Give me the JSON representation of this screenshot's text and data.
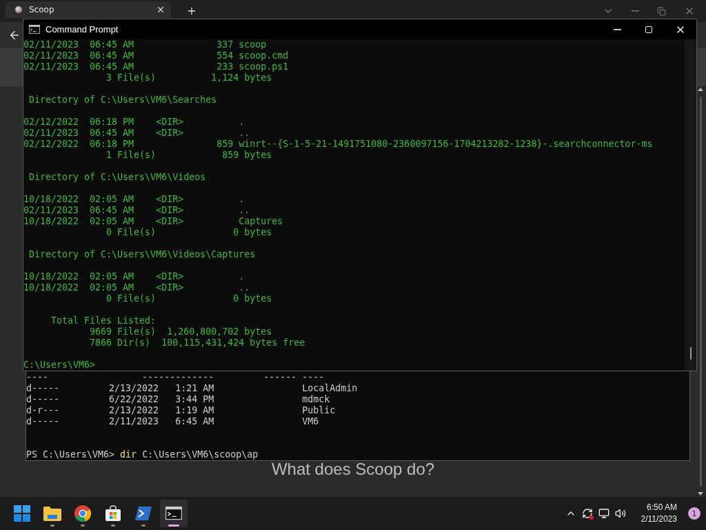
{
  "browser": {
    "tab": {
      "title": "Scoop"
    },
    "heading": "What does Scoop do?"
  },
  "powershell": {
    "lines": [
      "----                 -------------         ------ ----",
      "d-----         2/13/2022   1:21 AM                LocalAdmin",
      "d-----         6/22/2022   3:44 PM                mdmck",
      "d-r---         2/13/2022   1:19 AM                Public",
      "d-----         2/11/2023   6:45 AM                VM6"
    ],
    "prompt": "PS C:\\Users\\VM6>",
    "command": "dir",
    "argument": "C:\\Users\\VM6\\scoop\\ap"
  },
  "cmd": {
    "title": "Command Prompt",
    "blocks": [
      [
        "02/11/2023  06:45 AM               337 scoop",
        "02/11/2023  06:45 AM               554 scoop.cmd",
        "02/11/2023  06:45 AM               233 scoop.ps1",
        "               3 File(s)          1,124 bytes"
      ],
      [
        " Directory of C:\\Users\\VM6\\Searches"
      ],
      [
        "02/12/2022  06:18 PM    <DIR>          .",
        "02/11/2023  06:45 AM    <DIR>          ..",
        "02/12/2022  06:18 PM               859 winrt--{S-1-5-21-1491751080-2360097156-1704213282-1238}-.searchconnector-ms",
        "               1 File(s)            859 bytes"
      ],
      [
        " Directory of C:\\Users\\VM6\\Videos"
      ],
      [
        "10/18/2022  02:05 AM    <DIR>          .",
        "02/11/2023  06:45 AM    <DIR>          ..",
        "10/18/2022  02:05 AM    <DIR>          Captures",
        "               0 File(s)              0 bytes"
      ],
      [
        " Directory of C:\\Users\\VM6\\Videos\\Captures"
      ],
      [
        "10/18/2022  02:05 AM    <DIR>          .",
        "10/18/2022  02:05 AM    <DIR>          ..",
        "               0 File(s)              0 bytes"
      ],
      [
        "     Total Files Listed:",
        "            9669 File(s)  1,260,800,702 bytes",
        "            7866 Dir(s)  100,115,431,424 bytes free"
      ],
      [
        "C:\\Users\\VM6>"
      ]
    ]
  },
  "taskbar": {
    "apps": [
      {
        "kind": "start"
      },
      {
        "kind": "folder",
        "selected": false
      },
      {
        "kind": "browser",
        "selected": false
      },
      {
        "kind": "store",
        "selected": false
      },
      {
        "kind": "powershell",
        "selected": false
      },
      {
        "kind": "terminal",
        "selected": true
      }
    ],
    "time": "6:50 AM",
    "date": "2/11/2023",
    "badge": "1"
  }
}
